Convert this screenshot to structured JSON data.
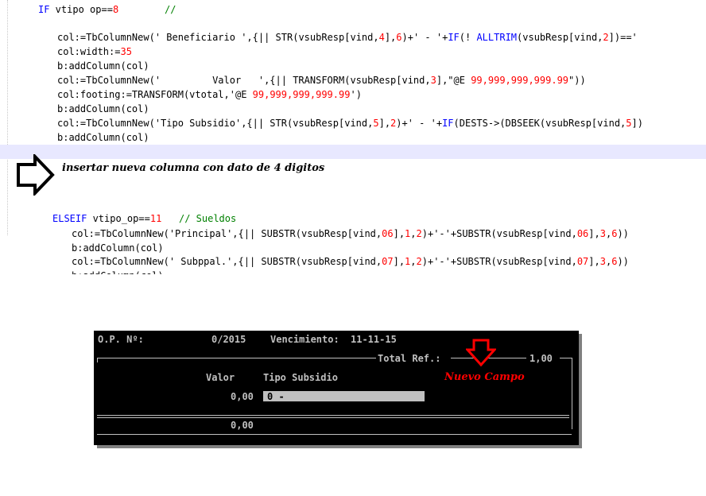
{
  "code_lines": [
    {
      "tokens": [
        [
          "kw",
          "IF"
        ],
        [
          "plain",
          " vtipo "
        ],
        [
          "plain",
          "op"
        ],
        [
          "plain",
          "=="
        ],
        [
          "num",
          "8"
        ],
        [
          "plain",
          "        "
        ],
        [
          "cm",
          "//"
        ]
      ]
    },
    {
      "tokens": [
        [
          "plain",
          "col:=TbColumnNew('"
        ],
        [
          "plain",
          " Beneficiario "
        ],
        [
          "plain",
          "',{|| STR(vsubResp[vind,"
        ],
        [
          "num",
          "4"
        ],
        [
          "plain",
          "],"
        ],
        [
          "num",
          "6"
        ],
        [
          "plain",
          ")+' - '+"
        ],
        [
          "kw",
          "IF"
        ],
        [
          "plain",
          "(! "
        ],
        [
          "kw",
          "ALLTRIM"
        ],
        [
          "plain",
          "(vsubResp[vind,"
        ],
        [
          "num",
          "2"
        ],
        [
          "plain",
          "])=='"
        ]
      ]
    },
    {
      "tokens": [
        [
          "plain",
          "col:width:="
        ],
        [
          "num",
          "35"
        ]
      ]
    },
    {
      "tokens": [
        [
          "plain",
          "b:addColumn(col)"
        ]
      ]
    },
    {
      "tokens": [
        [
          "plain",
          "col:=TbColumnNew('         Valor   ',{|| TRANSFORM(vsubResp[vind,"
        ],
        [
          "num",
          "3"
        ],
        [
          "plain",
          "],\"@E "
        ],
        [
          "num",
          "99,999,999,999.99"
        ],
        [
          "plain",
          "\"))"
        ]
      ]
    },
    {
      "tokens": [
        [
          "plain",
          "col:footing:=TRANSFORM(vtotal,'@E "
        ],
        [
          "num",
          "99,999,999,999.99"
        ],
        [
          "plain",
          "')"
        ]
      ]
    },
    {
      "tokens": [
        [
          "plain",
          "b:addColumn(col)"
        ]
      ]
    },
    {
      "tokens": [
        [
          "plain",
          "col:=TbColumnNew('Tipo Subsidio',{|| STR(vsubResp[vind,"
        ],
        [
          "num",
          "5"
        ],
        [
          "plain",
          "],"
        ],
        [
          "num",
          "2"
        ],
        [
          "plain",
          ")+' - '+"
        ],
        [
          "kw",
          "IF"
        ],
        [
          "plain",
          "(DESTS->(DBSEEK(vsubResp[vind,"
        ],
        [
          "num",
          "5"
        ],
        [
          "plain",
          "])"
        ]
      ]
    },
    {
      "tokens": [
        [
          "plain",
          "b:addColumn(col)"
        ]
      ]
    },
    {
      "tokens": [
        [
          "kw",
          "ELSEIF"
        ],
        [
          "plain",
          " vtipo_op=="
        ],
        [
          "num",
          "11"
        ],
        [
          "plain",
          "   "
        ],
        [
          "cm",
          "// Sueldos"
        ]
      ]
    },
    {
      "tokens": [
        [
          "plain",
          "col:=TbColumnNew('Principal',{|| SUBSTR(vsubResp[vind,"
        ],
        [
          "num",
          "06"
        ],
        [
          "plain",
          "],"
        ],
        [
          "num",
          "1"
        ],
        [
          "plain",
          ","
        ],
        [
          "num",
          "2"
        ],
        [
          "plain",
          ")+'-'+SUBSTR(vsubResp[vind,"
        ],
        [
          "num",
          "06"
        ],
        [
          "plain",
          "],"
        ],
        [
          "num",
          "3"
        ],
        [
          "plain",
          ","
        ],
        [
          "num",
          "6"
        ],
        [
          "plain",
          "))"
        ]
      ]
    },
    {
      "tokens": [
        [
          "plain",
          "b:addColumn(col)"
        ]
      ]
    },
    {
      "tokens": [
        [
          "plain",
          "col:=TbColumnNew(' Subppal.',{|| SUBSTR(vsubResp[vind,"
        ],
        [
          "num",
          "07"
        ],
        [
          "plain",
          "],"
        ],
        [
          "num",
          "1"
        ],
        [
          "plain",
          ","
        ],
        [
          "num",
          "2"
        ],
        [
          "plain",
          ")+'-'+SUBSTR(vsubResp[vind,"
        ],
        [
          "num",
          "07"
        ],
        [
          "plain",
          "],"
        ],
        [
          "num",
          "3"
        ],
        [
          "plain",
          ","
        ],
        [
          "num",
          "6"
        ],
        [
          "plain",
          "))"
        ]
      ]
    },
    {
      "tokens": [
        [
          "plain",
          "b:addColumn(col)"
        ]
      ]
    }
  ],
  "annotation": "insertar nueva columna con dato de 4 digitos",
  "dos": {
    "op_label": "O.P. Nº:",
    "op_value": "0/2015",
    "venc_label": "Vencimiento:",
    "venc_value": "11-11-15",
    "total_label": "Total Ref.:",
    "total_value": "1,00",
    "col_valor": "Valor",
    "col_tipo": "Tipo Subsidio",
    "row_valor": "0,00",
    "row_tipo": "0 -",
    "footer_valor": "0,00",
    "nuevo_campo": "Nuevo Campo"
  },
  "colors": {
    "keyword": "#0000ff",
    "number": "#ff0000",
    "comment": "#008000",
    "highlight": "#e8e8ff",
    "dos_text": "#c0c0c0",
    "accent": "#ff0000"
  }
}
